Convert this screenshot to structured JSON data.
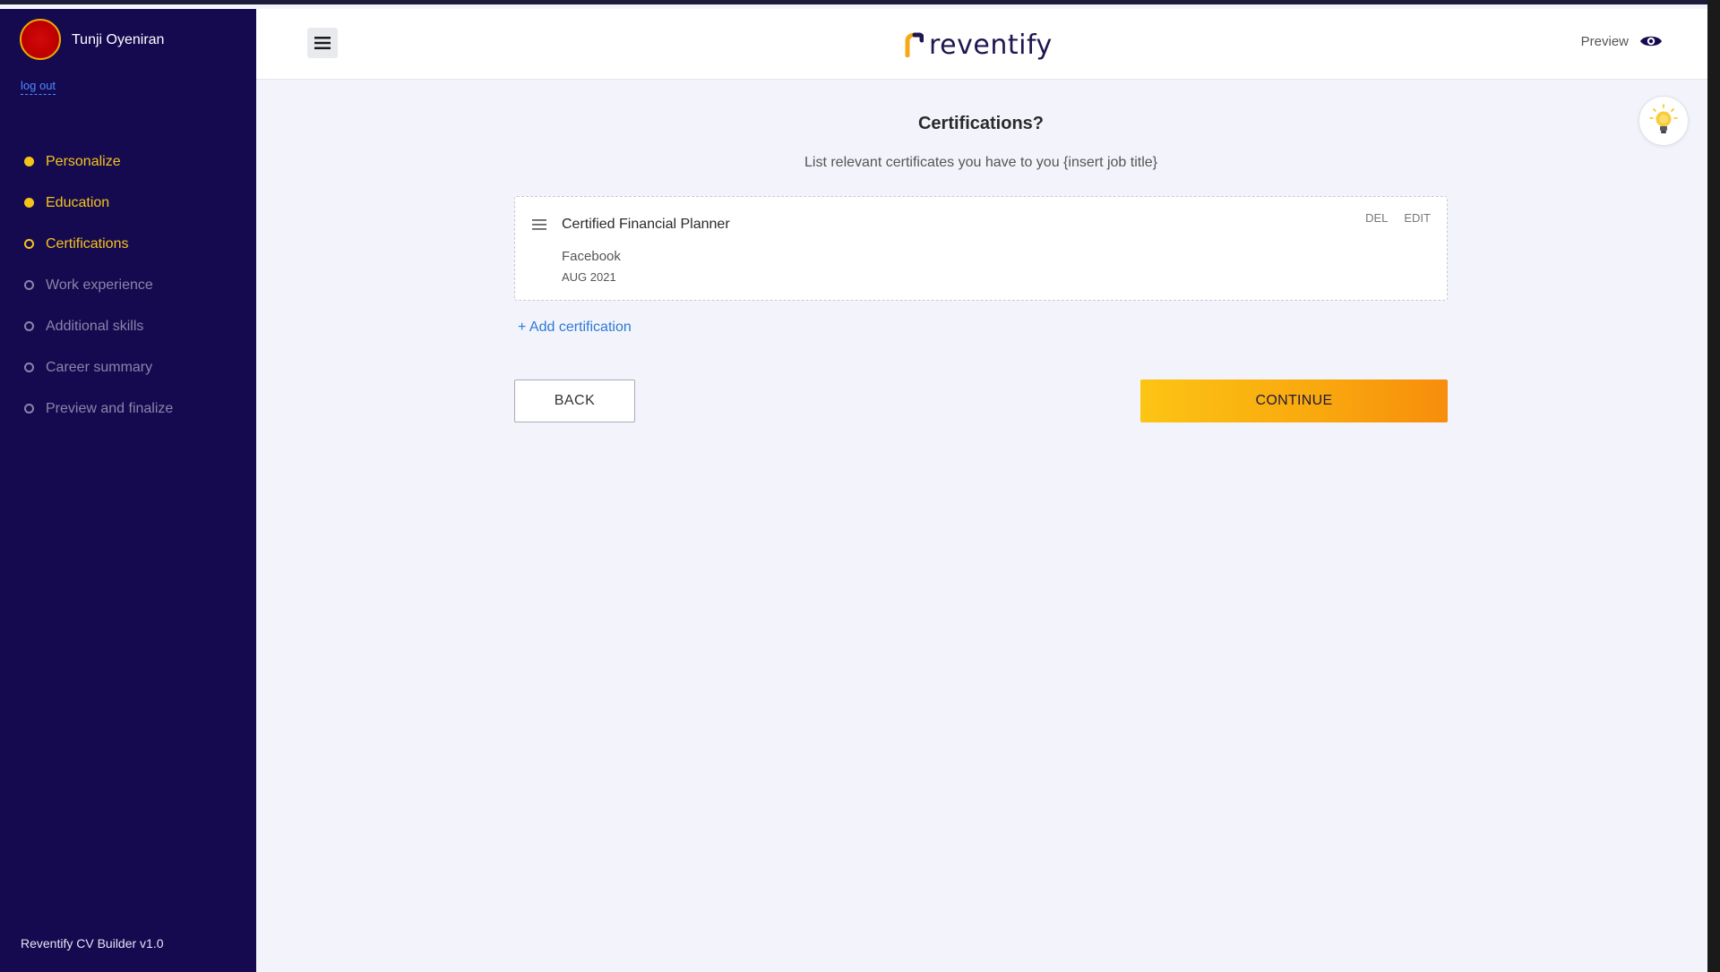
{
  "user": {
    "name": "Tunji Oyeniran",
    "logout_label": "log out"
  },
  "steps": [
    {
      "label": "Personalize",
      "state": "done"
    },
    {
      "label": "Education",
      "state": "done"
    },
    {
      "label": "Certifications",
      "state": "active"
    },
    {
      "label": "Work experience",
      "state": "pending"
    },
    {
      "label": "Additional skills",
      "state": "pending"
    },
    {
      "label": "Career summary",
      "state": "pending"
    },
    {
      "label": "Preview and finalize",
      "state": "pending"
    }
  ],
  "sidebar": {
    "version": "Reventify CV Builder v1.0"
  },
  "header": {
    "logo_text": "reventify",
    "preview_label": "Preview"
  },
  "main": {
    "title": "Certifications?",
    "subtitle": "List relevant certificates you have to you {insert job title}",
    "certifications": [
      {
        "name": "Certified Financial Planner",
        "organization": "Facebook",
        "date": "AUG 2021"
      }
    ],
    "del_label": "DEL",
    "edit_label": "EDIT",
    "add_label": "+ Add certification",
    "back_label": "BACK",
    "continue_label": "CONTINUE"
  },
  "colors": {
    "sidebar_bg": "#150a50",
    "accent_yellow": "#f4c31a",
    "link_blue": "#2e79d6",
    "continue_gradient_start": "#fcc414",
    "continue_gradient_end": "#f78d0c"
  },
  "icons": {
    "menu": "hamburger-icon",
    "preview": "eye-icon",
    "tip": "lightbulb-icon",
    "drag": "drag-handle-icon"
  }
}
